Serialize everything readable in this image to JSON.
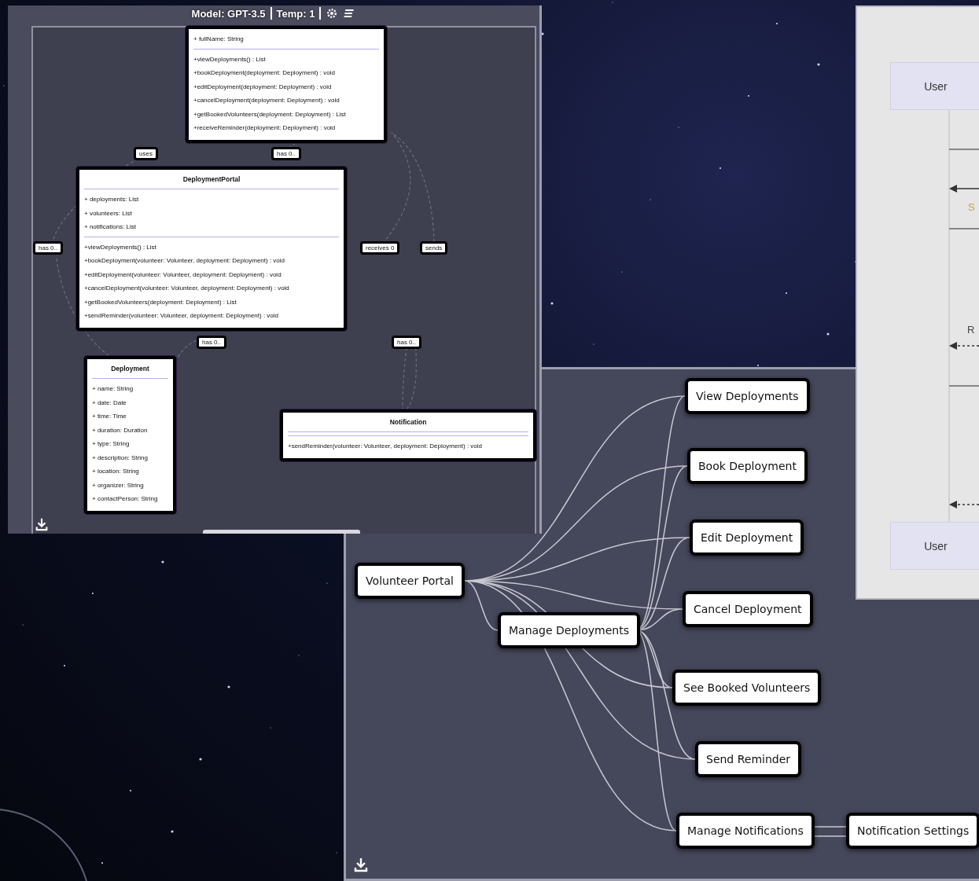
{
  "uml_window": {
    "toolbar": {
      "model": "Model: GPT-3.5",
      "temperature": "Temp: 1"
    },
    "classes": [
      {
        "attributes": [
          "+ fullName: String"
        ],
        "methods": [
          "+viewDeployments() : List",
          "+bookDeployment(deployment: Deployment) : void",
          "+editDeployment(deployment: Deployment) : void",
          "+cancelDeployment(deployment: Deployment) : void",
          "+getBookedVolunteers(deployment: Deployment) : List",
          "+receiveReminder(deployment: Deployment) : void"
        ]
      },
      {
        "name": "DeploymentPortal",
        "attributes": [
          "+ deployments: List",
          "+ volunteers: List",
          "+ notifications: List"
        ],
        "methods": [
          "+viewDeployments() : List",
          "+bookDeployment(volunteer: Volunteer, deployment: Deployment) : void",
          "+editDeployment(volunteer: Volunteer, deployment: Deployment) : void",
          "+cancelDeployment(volunteer: Volunteer, deployment: Deployment) : void",
          "+getBookedVolunteers(deployment: Deployment) : List",
          "+sendReminder(volunteer: Volunteer, deployment: Deployment) : void"
        ]
      },
      {
        "name": "Deployment",
        "attributes": [
          "+ name: String",
          "+ date: Date",
          "+ time: Time",
          "+ duration: Duration",
          "+ type: String",
          "+ description: String",
          "+ location: String",
          "+ organizer: String",
          "+ contactPerson: String"
        ]
      },
      {
        "name": "Notification",
        "methods": [
          "+sendReminder(volunteer: Volunteer, deployment: Deployment) : void"
        ]
      }
    ],
    "edge_labels": [
      "uses",
      "has 0..",
      "has 0..",
      "receives 0",
      "sends",
      "has 0..",
      "has 0.."
    ]
  },
  "mindmap_window": {
    "nodes": [
      "Volunteer Portal",
      "Manage Deployments",
      "View Deployments",
      "Book Deployment",
      "Edit Deployment",
      "Cancel Deployment",
      "See Booked Volunteers",
      "Send Reminder",
      "Manage Notifications",
      "Notification Settings"
    ]
  },
  "sequence_window": {
    "participants": [
      "User",
      "User"
    ],
    "message_labels": [
      "S",
      "R"
    ]
  }
}
